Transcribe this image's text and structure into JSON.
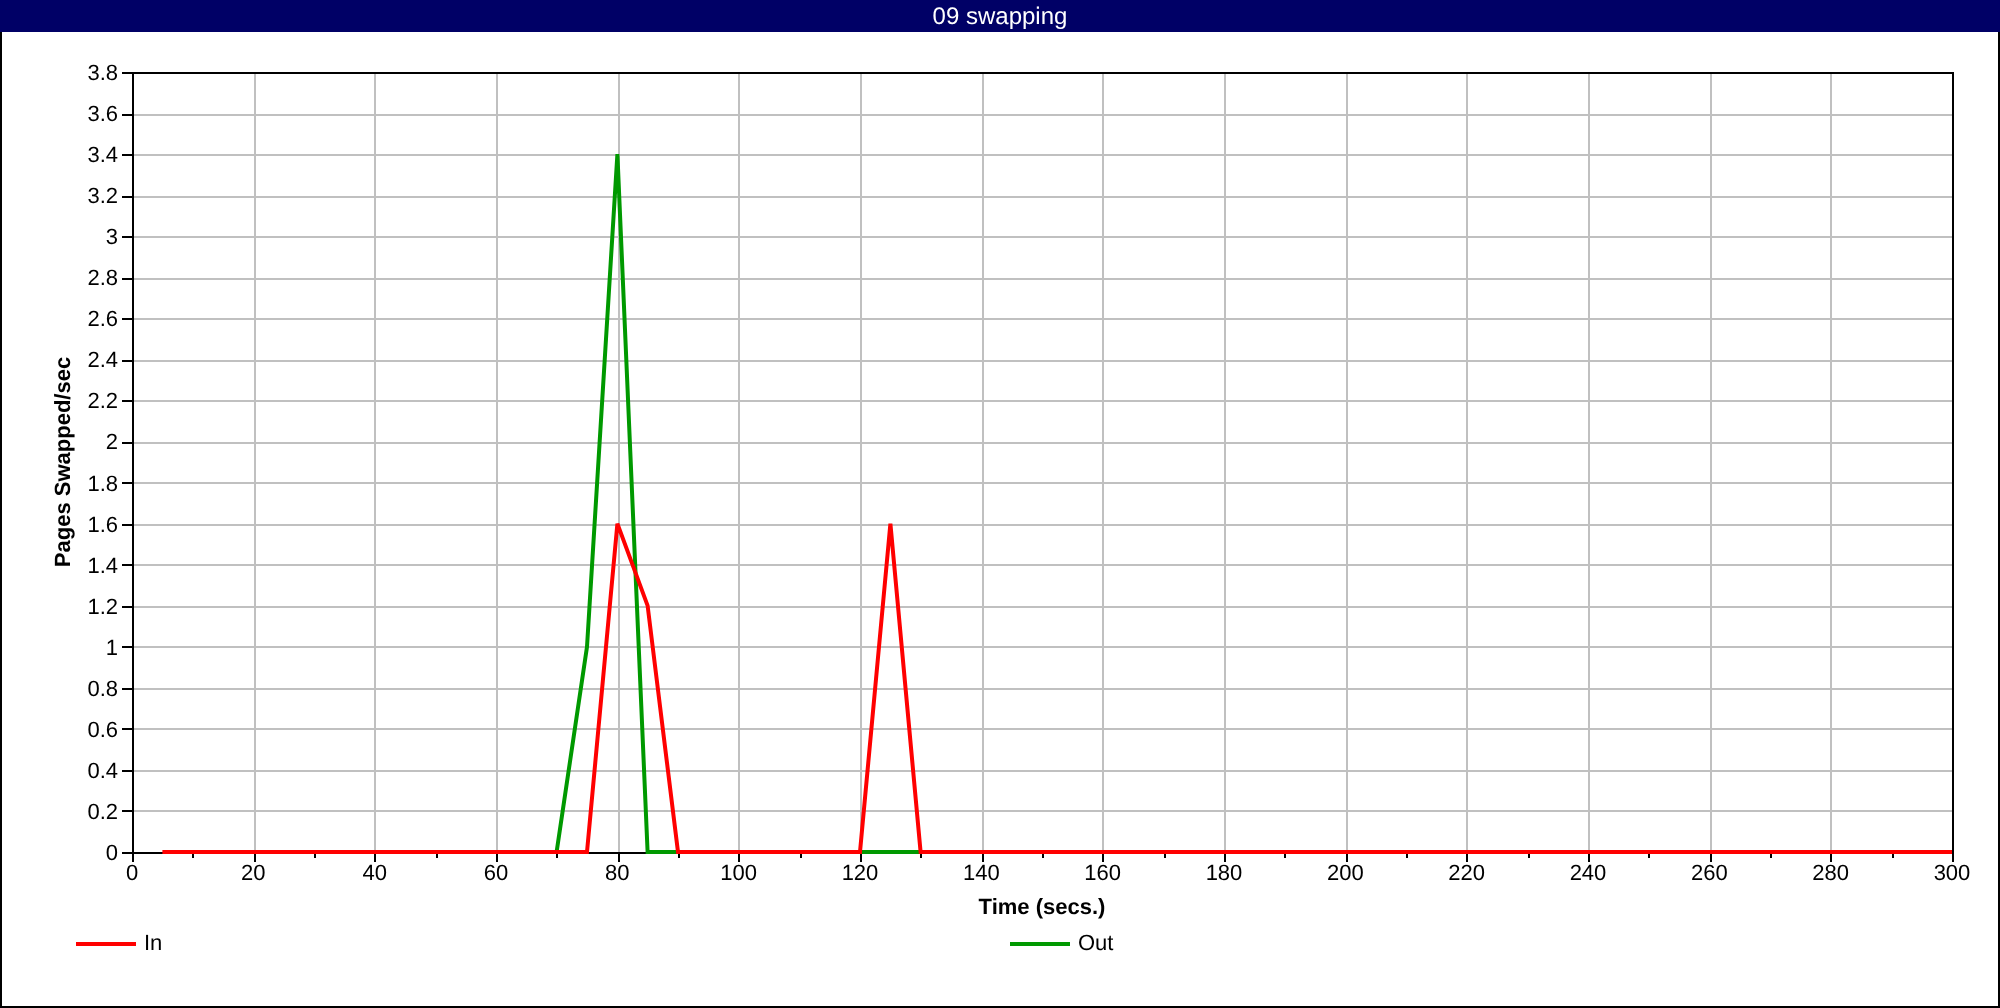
{
  "window": {
    "title": "09 swapping"
  },
  "chart": {
    "chart_data": {
      "type": "line",
      "xlabel": "Time (secs.)",
      "ylabel": "Pages Swapped/sec",
      "x": [
        5,
        10,
        15,
        20,
        25,
        30,
        35,
        40,
        45,
        50,
        55,
        60,
        65,
        70,
        75,
        80,
        85,
        90,
        95,
        100,
        105,
        110,
        115,
        120,
        125,
        130,
        135,
        140,
        145,
        150,
        155,
        160,
        165,
        170,
        175,
        180,
        185,
        190,
        195,
        200,
        205,
        210,
        215,
        220,
        225,
        230,
        235,
        240,
        245,
        250,
        255,
        260,
        265,
        270,
        275,
        280,
        285,
        290,
        295,
        300
      ],
      "series": [
        {
          "name": "Out",
          "color": "#009900",
          "values": [
            null,
            null,
            null,
            null,
            null,
            null,
            null,
            null,
            null,
            null,
            null,
            null,
            null,
            0,
            1,
            3.4,
            0,
            0,
            null,
            null,
            null,
            null,
            null,
            0,
            0,
            0,
            null,
            null,
            null,
            null,
            null,
            null,
            null,
            null,
            null,
            null,
            null,
            null,
            null,
            null,
            null,
            null,
            null,
            null,
            null,
            null,
            null,
            null,
            null,
            null,
            null,
            null,
            null,
            null,
            null,
            null,
            null,
            null,
            null,
            null
          ]
        },
        {
          "name": "In",
          "color": "#ff0000",
          "values": [
            0,
            0,
            0,
            0,
            0,
            0,
            0,
            0,
            0,
            0,
            0,
            0,
            0,
            0,
            0,
            1.6,
            1.2,
            0,
            0,
            0,
            0,
            0,
            0,
            0,
            1.6,
            0,
            0,
            0,
            0,
            0,
            0,
            0,
            0,
            0,
            0,
            0,
            0,
            0,
            0,
            0,
            0,
            0,
            0,
            0,
            0,
            0,
            0,
            0,
            0,
            0,
            0,
            0,
            0,
            0,
            0,
            0,
            0,
            0,
            0,
            0
          ]
        }
      ],
      "grid": true,
      "xlim": [
        0,
        300
      ],
      "ylim": [
        0,
        3.8
      ],
      "xticks": [
        0,
        20,
        40,
        60,
        80,
        100,
        120,
        140,
        160,
        180,
        200,
        220,
        240,
        260,
        280,
        300
      ],
      "yticks": [
        0,
        0.2,
        0.4,
        0.6,
        0.8,
        1,
        1.2,
        1.4,
        1.6,
        1.8,
        2,
        2.2,
        2.4,
        2.6,
        2.8,
        3,
        3.2,
        3.4,
        3.6,
        3.8
      ]
    }
  }
}
